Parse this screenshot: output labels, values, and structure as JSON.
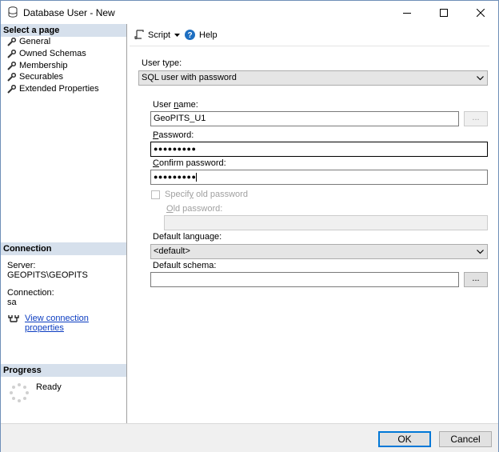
{
  "window": {
    "title": "Database User - New"
  },
  "left_panel": {
    "select_page_header": "Select a page",
    "pages": [
      {
        "label": "General",
        "selected": true
      },
      {
        "label": "Owned Schemas",
        "selected": false
      },
      {
        "label": "Membership",
        "selected": false
      },
      {
        "label": "Securables",
        "selected": false
      },
      {
        "label": "Extended Properties",
        "selected": false
      }
    ],
    "connection_header": "Connection",
    "server_label": "Server:",
    "server_value": "GEOPITS\\GEOPITS",
    "connection_label": "Connection:",
    "connection_value": "sa",
    "view_connection_link": "View connection properties",
    "progress_header": "Progress",
    "progress_status": "Ready"
  },
  "toolbar": {
    "script_label": "Script",
    "help_label": "Help"
  },
  "form": {
    "user_type_label": "User type:",
    "user_type_value": "SQL user with password",
    "user_name_label_pre": "User ",
    "user_name_label_u": "n",
    "user_name_label_post": "ame:",
    "user_name_value": "GeoPITS_U1",
    "browse_label": "...",
    "password_label_u": "P",
    "password_label_post": "assword:",
    "password_value": "●●●●●●●●●",
    "confirm_label_u": "C",
    "confirm_label_post": "onfirm password:",
    "confirm_value": "●●●●●●●●●",
    "specify_old_label_pre": "Specif",
    "specify_old_label_u": "y",
    "specify_old_label_post": " old password",
    "old_password_label_u": "O",
    "old_password_label_post": "ld password:",
    "old_password_value": "",
    "default_language_label": "Default language:",
    "default_language_value": "<default>",
    "default_schema_label": "Default schema:",
    "default_schema_value": ""
  },
  "buttons": {
    "ok": "OK",
    "cancel": "Cancel"
  },
  "colors": {
    "section_header_bg": "#d6e0ec",
    "link": "#0b3cc1",
    "default_button_border": "#0078d7",
    "help_icon": "#1e6fc1"
  }
}
